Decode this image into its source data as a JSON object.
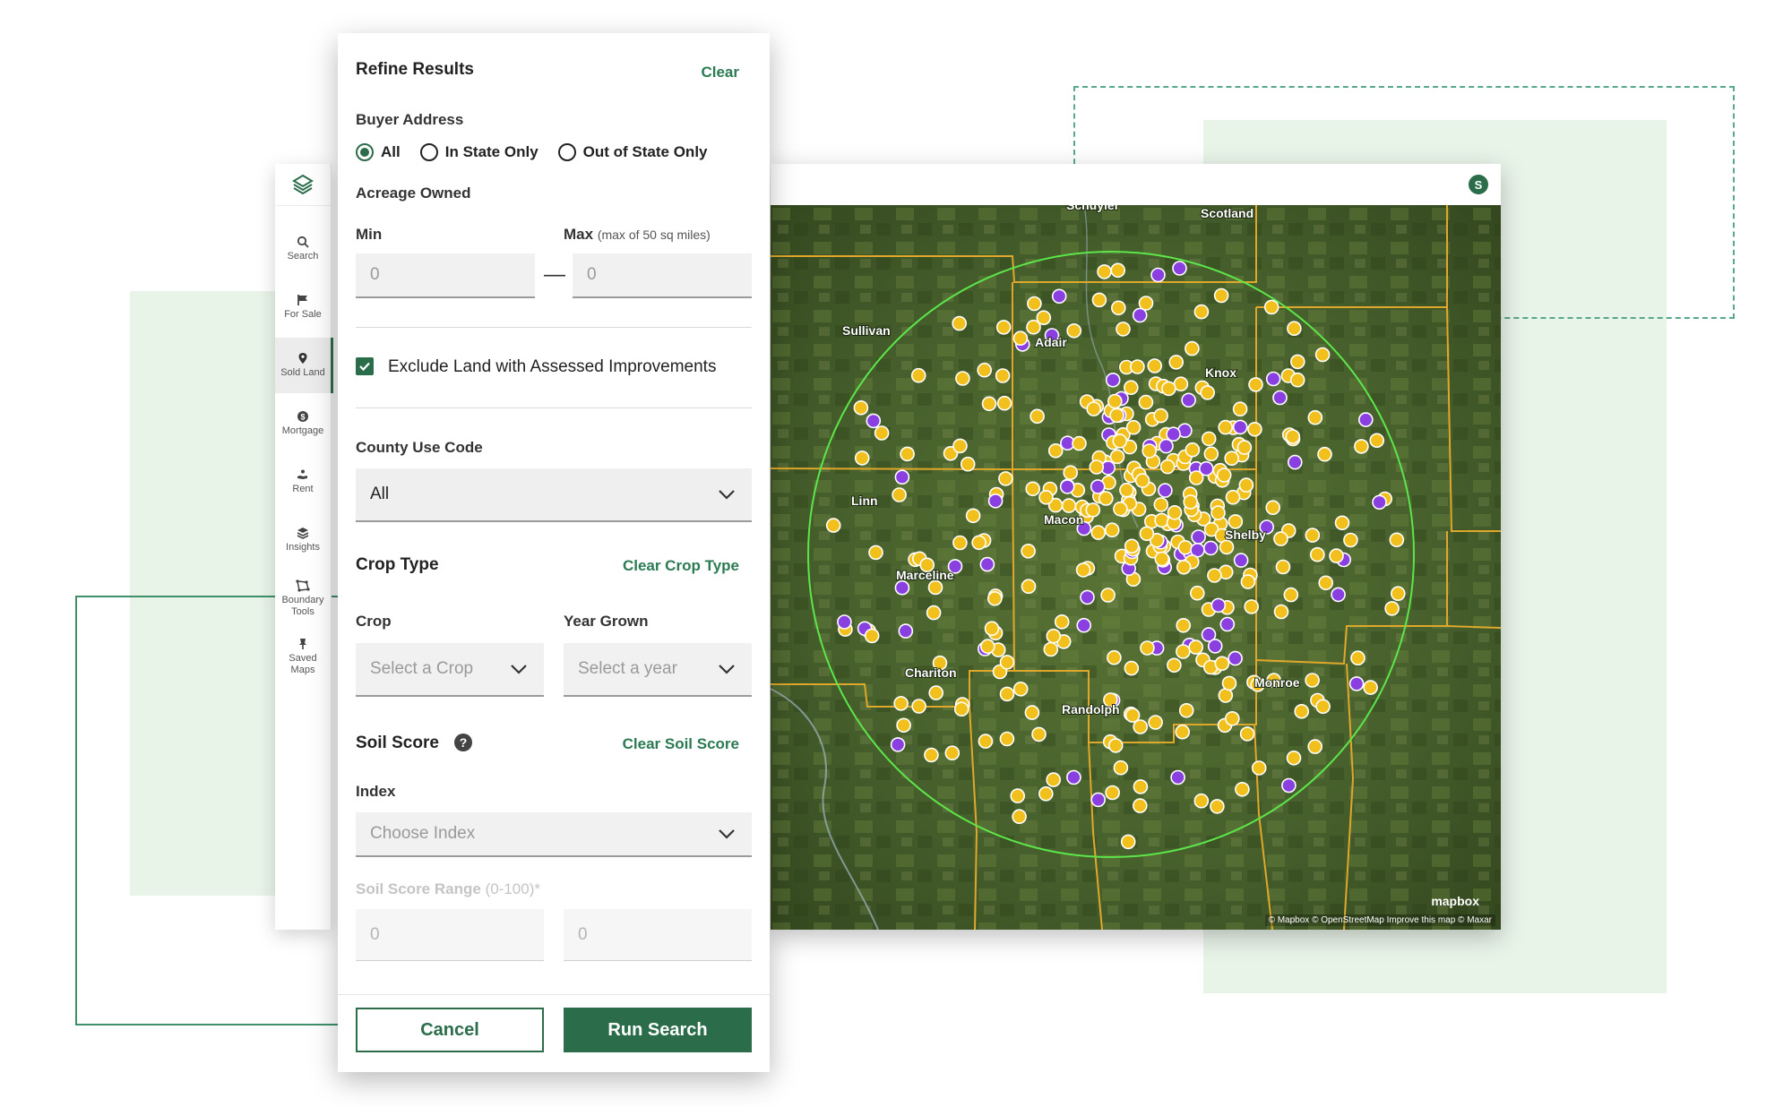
{
  "colors": {
    "accent": "#2b6d4a",
    "link": "#2b7a52",
    "marker_sold": "#f2c01c",
    "marker_purple": "#8a3fe0",
    "county_line": "#e0a82a",
    "radius_circle": "#5de64a"
  },
  "sidebar": {
    "logo_icon": "layers-logo-icon",
    "items": [
      {
        "label": "Search",
        "icon": "search-icon"
      },
      {
        "label": "For Sale",
        "icon": "flag-icon"
      },
      {
        "label": "Sold Land",
        "icon": "map-pin-icon",
        "active": true
      },
      {
        "label": "Mortgage",
        "icon": "dollar-icon"
      },
      {
        "label": "Rent",
        "icon": "hand-icon"
      },
      {
        "label": "Insights",
        "icon": "stack-icon"
      },
      {
        "label": "Boundary Tools",
        "icon": "polygon-icon"
      },
      {
        "label": "Saved Maps",
        "icon": "pin-icon"
      }
    ]
  },
  "map": {
    "user_avatar": "S",
    "towns": [
      "Schuyler",
      "Scotland",
      "Sullivan",
      "Adair",
      "Knox",
      "Linn",
      "Macon",
      "Shelby",
      "Marceline",
      "Chariton",
      "Randolph",
      "Monroe"
    ],
    "attribution": "© Mapbox © OpenStreetMap Improve this map © Maxar",
    "logo": "mapbox"
  },
  "panel": {
    "title": "Refine Results",
    "clear": "Clear",
    "buyer_address": {
      "label": "Buyer Address",
      "options": [
        "All",
        "In State Only",
        "Out of State Only"
      ],
      "selected": "All"
    },
    "acreage": {
      "label": "Acreage Owned",
      "min_label": "Min",
      "max_label": "Max",
      "max_note": "(max of 50 sq miles)",
      "min_value": "0",
      "max_value": "0",
      "dash": "—"
    },
    "exclude_label": "Exclude Land with Assessed Improvements",
    "exclude_checked": true,
    "county_use": {
      "label": "County Use Code",
      "value": "All"
    },
    "crop_type": {
      "title": "Crop Type",
      "clear": "Clear Crop Type",
      "crop_label": "Crop",
      "crop_placeholder": "Select a Crop",
      "year_label": "Year Grown",
      "year_placeholder": "Select a year"
    },
    "soil": {
      "title": "Soil Score",
      "clear": "Clear Soil Score",
      "index_label": "Index",
      "index_placeholder": "Choose Index",
      "range_label": "Soil Score Range",
      "range_note": "(0-100)*",
      "range_min": "0",
      "range_max": "0"
    },
    "cancel": "Cancel",
    "run": "Run Search"
  }
}
